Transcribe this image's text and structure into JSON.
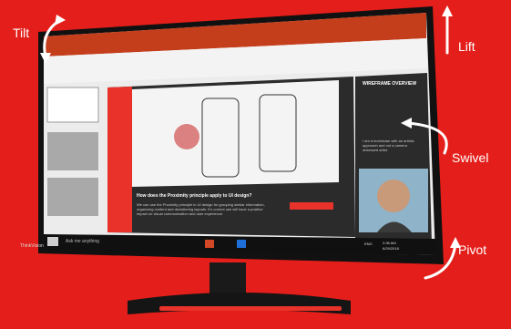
{
  "labels": {
    "tilt": "Tilt",
    "lift": "Lift",
    "swivel": "Swivel",
    "pivot": "Pivot"
  },
  "monitor": {
    "brand": "ThinkVision"
  },
  "slide": {
    "panel_title": "WIREFRAME OVERVIEW",
    "bio": "I am a technician with an artistic approach and not a camera obsessed artist.",
    "question": "How does the Proximity principle apply to UI design?",
    "body": "We can use the Proximity principle in UI design for grouping similar information, organizing content and decluttering layouts. It's correct use will have a positive impact on visual communication and user experience."
  },
  "taskbar": {
    "search_placeholder": "Ask me anything",
    "language": "ENG",
    "time": "2:36 AM",
    "date": "6/29/2018"
  },
  "colors": {
    "background": "#e41e1a",
    "ribbon": "#c43e1c",
    "screen_dark": "#2b2b2b"
  }
}
